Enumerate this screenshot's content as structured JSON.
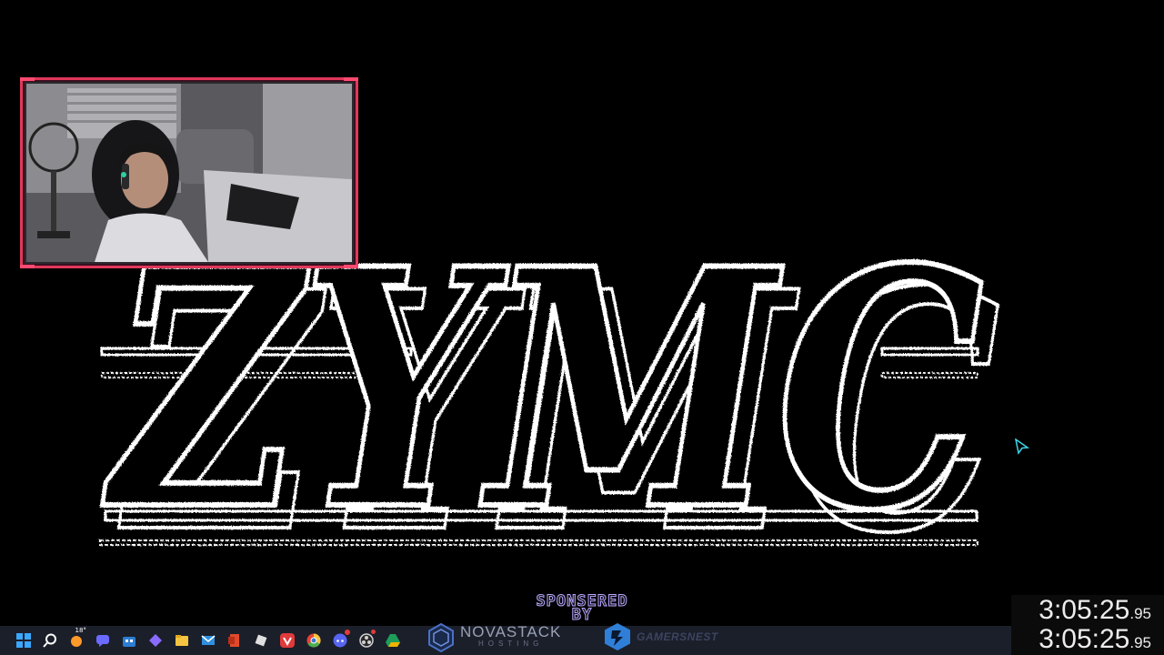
{
  "stream": {
    "logo_text": "ZYMC",
    "sponsor_line1": "SPONSERED",
    "sponsor_line2": "BY"
  },
  "sponsors": [
    {
      "name": "NOVASTACK",
      "subtitle": "HOSTING",
      "icon": "novastack-logo-icon"
    },
    {
      "name": "GAMERSNEST",
      "icon": "gamersnest-logo-icon"
    }
  ],
  "timer": {
    "primary": {
      "main": "3:05:25",
      "centiseconds": ".95"
    },
    "secondary": {
      "main": "3:05:25",
      "centiseconds": ".95"
    }
  },
  "taskbar": {
    "weather_temp": "18°",
    "icons": [
      {
        "name": "start-icon",
        "color": "#3aa8ff"
      },
      {
        "name": "search-icon",
        "color": "#ffffff"
      },
      {
        "name": "weather-icon",
        "color": "#ff9a2a"
      },
      {
        "name": "chat-icon",
        "color": "#6b6bff"
      },
      {
        "name": "store-icon",
        "color": "#2d7dd2"
      },
      {
        "name": "app-icon",
        "color": "#8a6bff"
      },
      {
        "name": "file-explorer-icon",
        "color": "#f5c542"
      },
      {
        "name": "mail-icon",
        "color": "#2f8fe0"
      },
      {
        "name": "office-icon",
        "color": "#e04a2a"
      },
      {
        "name": "app-white-icon",
        "color": "#e0e0e0"
      },
      {
        "name": "vivaldi-icon",
        "color": "#e03a3a"
      },
      {
        "name": "chrome-icon",
        "color": "#4caf50"
      },
      {
        "name": "discord-icon",
        "color": "#5865f2"
      },
      {
        "name": "obs-icon",
        "color": "#d0d0d0"
      },
      {
        "name": "drive-icon",
        "color": "#f0b400"
      }
    ]
  },
  "colors": {
    "webcam_border": "#e0385a",
    "cursor": "#3fd4e8",
    "sponsor_outline": "#b7a6ff"
  }
}
